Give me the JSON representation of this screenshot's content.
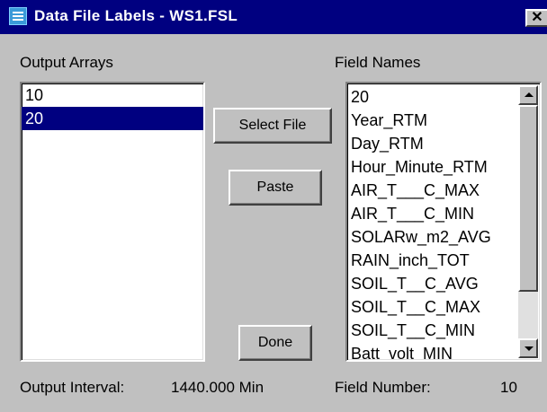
{
  "window": {
    "title": "Data File Labels - WS1.FSL",
    "close_label": "✕"
  },
  "output_arrays": {
    "label": "Output Arrays",
    "items": [
      "10",
      "20"
    ],
    "selected": "20"
  },
  "field_names": {
    "label": "Field Names",
    "items": [
      "20",
      "Year_RTM",
      "Day_RTM",
      "Hour_Minute_RTM",
      "AIR_T___C_MAX",
      "AIR_T___C_MIN",
      "SOLARw_m2_AVG",
      "RAIN_inch_TOT",
      "SOIL_T__C_AVG",
      "SOIL_T__C_MAX",
      "SOIL_T__C_MIN",
      "Batt_volt_MIN"
    ]
  },
  "buttons": {
    "select_file": "Select File",
    "paste": "Paste",
    "done": "Done"
  },
  "status": {
    "output_interval_label": "Output Interval:",
    "output_interval_value": "1440.000 Min",
    "field_number_label": "Field Number:",
    "field_number_value": "10"
  },
  "icons": {
    "window_icon": "data-file-icon",
    "close_icon": "close-icon",
    "scroll_up_icon": "arrow-up-icon",
    "scroll_down_icon": "arrow-down-icon"
  },
  "colors": {
    "titlebar": "#000080",
    "selection": "#000080",
    "window_bg": "#c0c0c0"
  }
}
